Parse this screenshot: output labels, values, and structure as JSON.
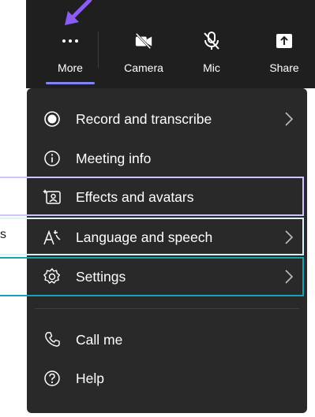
{
  "toolbar": {
    "more_label": "More",
    "more_icon": "ellipsis-icon",
    "camera_label": "Camera",
    "camera_icon": "camera-off-icon",
    "mic_label": "Mic",
    "mic_icon": "mic-off-icon",
    "share_label": "Share",
    "share_icon": "share-tray-icon"
  },
  "menu": {
    "items": [
      {
        "label": "Record and transcribe",
        "icon": "record-icon",
        "has_submenu": true
      },
      {
        "label": "Meeting info",
        "icon": "info-icon",
        "has_submenu": false
      },
      {
        "label": "Effects and avatars",
        "icon": "effects-icon",
        "has_submenu": false
      },
      {
        "label": "Language and speech",
        "icon": "language-icon",
        "has_submenu": true
      },
      {
        "label": "Settings",
        "icon": "gear-icon",
        "has_submenu": true
      },
      {
        "label": "Call me",
        "icon": "phone-icon",
        "has_submenu": false
      },
      {
        "label": "Help",
        "icon": "help-icon",
        "has_submenu": false
      }
    ]
  },
  "annotations": {
    "edge_text": "s",
    "highlight_colors": {
      "effects": "#cbc6ff",
      "language": "#d8f4f6",
      "settings": "#14a3b0"
    },
    "arrow_color": "#8b5cf6"
  },
  "colors": {
    "accent": "#7f85f5",
    "menu_bg": "#292929",
    "toolbar_bg": "#1f1f1f"
  }
}
